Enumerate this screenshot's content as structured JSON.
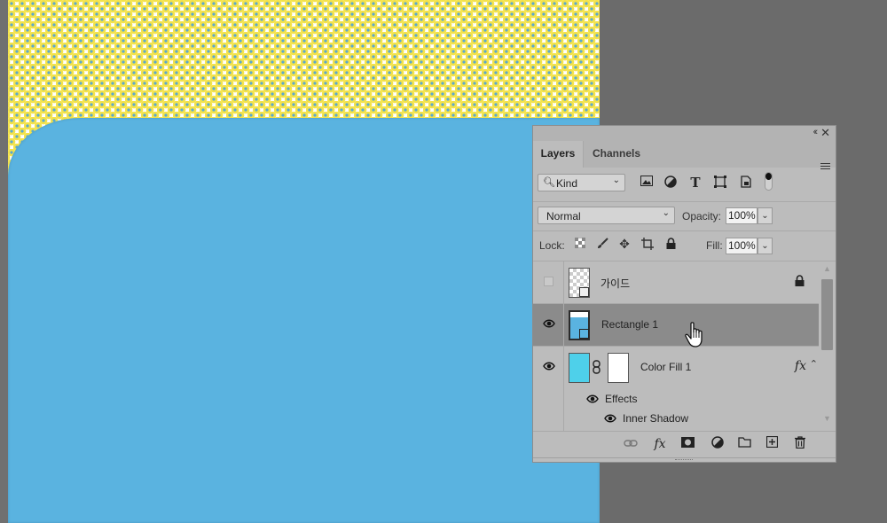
{
  "panel": {
    "collapse_glyph": "‹‹",
    "close_glyph": "✕",
    "tabs": [
      {
        "label": "Layers"
      },
      {
        "label": "Channels"
      }
    ],
    "filter": {
      "kind_label": "Kind",
      "icons": [
        "image-filter-icon",
        "adjustment-filter-icon",
        "type-filter-icon",
        "shape-filter-icon",
        "smart-object-filter-icon"
      ]
    },
    "blend_mode": "Normal",
    "opacity_label": "Opacity:",
    "opacity_value": "100%",
    "lock_label": "Lock:",
    "fill_label": "Fill:",
    "fill_value": "100%"
  },
  "layers": [
    {
      "name": "가이드",
      "visible": false,
      "locked": true,
      "thumbnail": "checker-smart-object"
    },
    {
      "name": "Rectangle 1",
      "visible": true,
      "selected": true,
      "thumbnail": "rectangle-shape"
    },
    {
      "name": "Color Fill 1",
      "visible": true,
      "fx_badge": "fx",
      "thumbnail": "cyan-fill-with-mask",
      "effects_label": "Effects",
      "effects": [
        "Inner Shadow"
      ]
    }
  ],
  "bottom_toolbar": [
    "link-layers-icon",
    "fx-icon",
    "add-mask-icon",
    "adjustment-layer-icon",
    "new-group-icon",
    "new-layer-icon",
    "delete-icon"
  ],
  "fx_text": "fx",
  "colors": {
    "canvas_shape": "#5ab3e0",
    "pattern_yellow": "#f3e24a",
    "pattern_blue": "#5aa8cf",
    "panel_bg": "#bcbcbc",
    "selected_row": "#8b8b8b",
    "fill_thumb": "#4ed0ea"
  }
}
